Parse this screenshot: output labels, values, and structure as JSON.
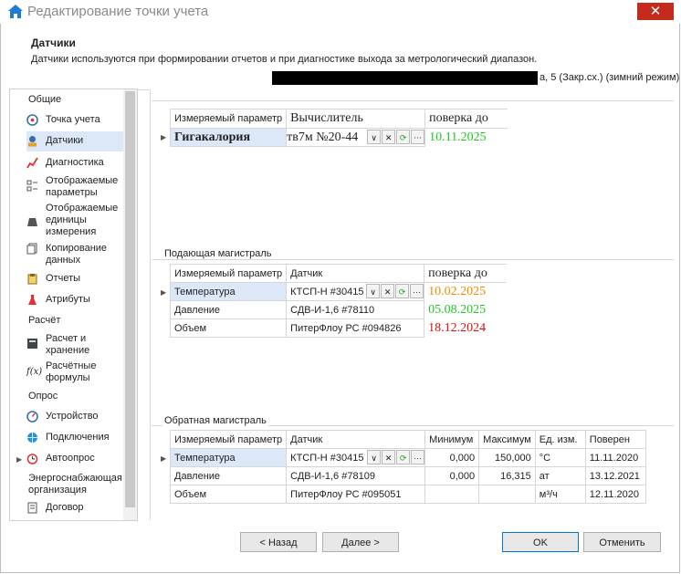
{
  "window": {
    "title": "Редактирование точки учета",
    "close_glyph": "✕"
  },
  "header": {
    "title": "Датчики",
    "description": "Датчики используются при формировании отчетов и при диагностике выхода за метрологический диапазон.",
    "address_suffix": "а, 5 (Закр.сх.) (зимний режим)"
  },
  "sidebar": {
    "groups": {
      "general": "Общие",
      "calc": "Расчёт",
      "poll": "Опрос",
      "org": "Энергоснабжающая организация"
    },
    "items": {
      "point": "Точка учета",
      "sensors": "Датчики",
      "diagnostics": "Диагностика",
      "displayed_params": "Отображаемые параметры",
      "displayed_units": "Отображаемые единицы измерения",
      "copy_data": "Копирование данных",
      "reports": "Отчеты",
      "attributes": "Атрибуты",
      "calc_storage": "Расчет и хранение",
      "formulas": "Расчётные формулы",
      "device": "Устройство",
      "connections": "Подключения",
      "autopoll": "Автоопрос",
      "contract": "Договор"
    }
  },
  "calculator": {
    "headers": {
      "param": "Измеряемый параметр",
      "device": "Вычислитель",
      "verify": "поверка до"
    },
    "row": {
      "param": "Гигакалория",
      "device": "тв7м №20-44",
      "verify": "10.11.2025"
    }
  },
  "supply": {
    "title": "Подающая магистраль",
    "headers": {
      "param": "Измеряемый параметр",
      "sensor": "Датчик",
      "verify": "поверка до"
    },
    "rows": [
      {
        "param": "Температура",
        "sensor": "КТСП-Н #30415",
        "verify": "10.02.2025"
      },
      {
        "param": "Давление",
        "sensor": "СДВ-И-1,6 #78110",
        "verify": "05.08.2025"
      },
      {
        "param": "Объем",
        "sensor": "ПитерФлоу РС #094826",
        "verify": "18.12.2024"
      }
    ],
    "verify_colors": [
      "#f08c00",
      "#22c722",
      "#e01010"
    ]
  },
  "return": {
    "title": "Обратная магистраль",
    "headers": {
      "param": "Измеряемый параметр",
      "sensor": "Датчик",
      "min": "Минимум",
      "max": "Максимум",
      "unit": "Ед. изм.",
      "verified": "Поверен"
    },
    "rows": [
      {
        "param": "Температура",
        "sensor": "КТСП-Н #30415",
        "min": "0,000",
        "max": "150,000",
        "unit": "°C",
        "verified": "11.11.2020"
      },
      {
        "param": "Давление",
        "sensor": "СДВ-И-1,6 #78109",
        "min": "0,000",
        "max": "16,315",
        "unit": "ат",
        "verified": "13.12.2021"
      },
      {
        "param": "Объем",
        "sensor": "ПитерФлоу РС #095051",
        "min": "",
        "max": "",
        "unit": "м³/ч",
        "verified": "12.11.2020"
      }
    ]
  },
  "footer": {
    "back": "< Назад",
    "next": "Далее >",
    "ok": "OK",
    "cancel": "Отменить"
  },
  "colors": {
    "selection": "#dce8f7",
    "verify_green": "#22c722",
    "accent": "#0078d7"
  }
}
